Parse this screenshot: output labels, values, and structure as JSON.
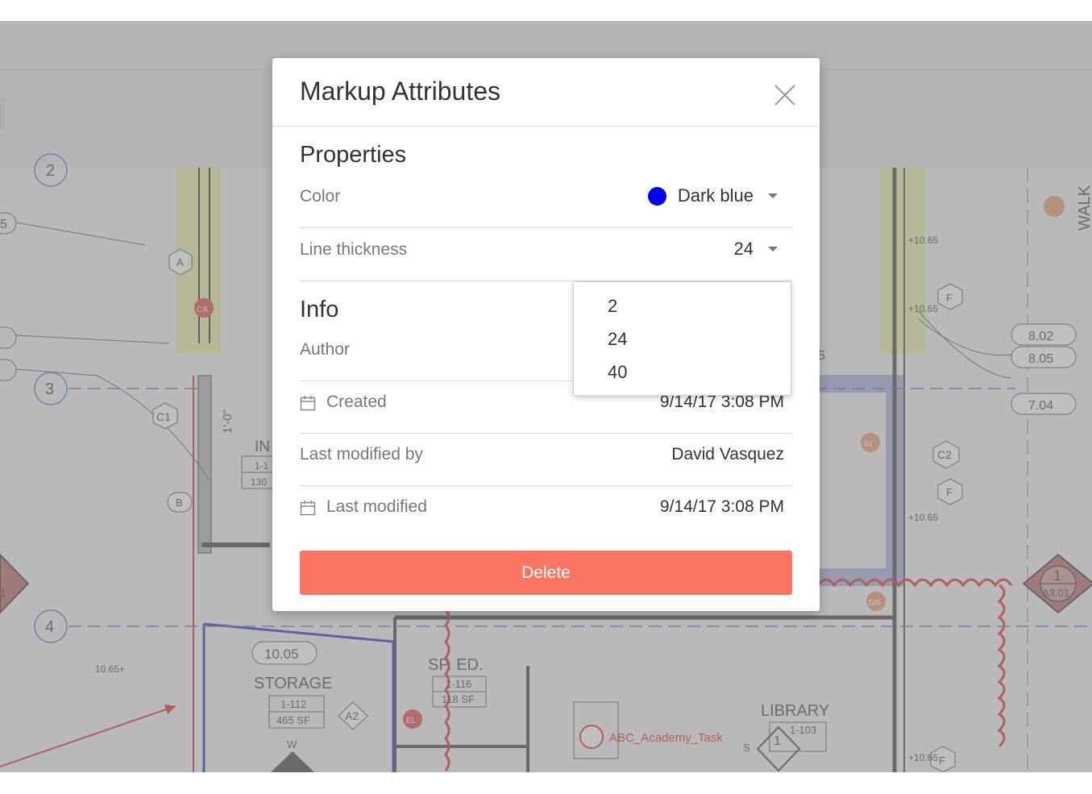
{
  "modal": {
    "title": "Markup Attributes",
    "properties": {
      "heading": "Properties",
      "color": {
        "label": "Color",
        "value": "Dark blue",
        "swatch": "#0000ee"
      },
      "line_thickness": {
        "label": "Line thickness",
        "value": "24"
      }
    },
    "info": {
      "heading": "Info",
      "author_label": "Author",
      "created": {
        "label": "Created",
        "value": "9/14/17 3:08 PM"
      },
      "last_modified_by": {
        "label": "Last modified by",
        "value": "David Vasquez"
      },
      "last_modified": {
        "label": "Last modified",
        "value": "9/14/17 3:08 PM"
      }
    },
    "delete_label": "Delete"
  },
  "thickness_dropdown": {
    "options": [
      "2",
      "24",
      "40"
    ]
  },
  "plan_labels": {
    "room_storage": "STORAGE",
    "room_storage_num": "1-112",
    "room_storage_area": "465 SF",
    "room_sped": "SP. ED.",
    "room_sped_num": "1-116",
    "room_sped_area": "118 SF",
    "room_library": "LIBRARY",
    "room_library_num": "1-103",
    "room_int": "IN",
    "room_int_num": "1-1",
    "room_int_area": "130",
    "task_label": "ABC_Academy_Task",
    "dim_1": "1'-0\"",
    "tag_c1": "C1",
    "tag_c2": "C2",
    "tag_a": "A",
    "tag_a2": "A2",
    "tag_b": "B",
    "tag_f1": "F",
    "tag_f2": "F",
    "tag_f3": "F",
    "tag_w": "W",
    "tag_s": "S",
    "grid_2": "2",
    "grid_3": "3",
    "grid_4": "4",
    "grid_5a": "5",
    "grid_5b": "5",
    "elev_10_65a": "+10.65",
    "elev_10_65b": "+10.65",
    "elev_10_65c": "+10.65",
    "elev_10_65d": "+10.65",
    "elev_10_65e": "10.65+",
    "callout_10_05": "10.05",
    "callout_8_02": "8.02",
    "callout_8_05": "8.05",
    "callout_7_04": "7.04",
    "section_1": "1",
    "section_a301": "A3.01",
    "section_left": "1",
    "library_1": "1",
    "walk": "WALK",
    "pin_ca": "CA",
    "pin_in": "IN",
    "pin_dr": "DR",
    "pin_el": "EL"
  }
}
